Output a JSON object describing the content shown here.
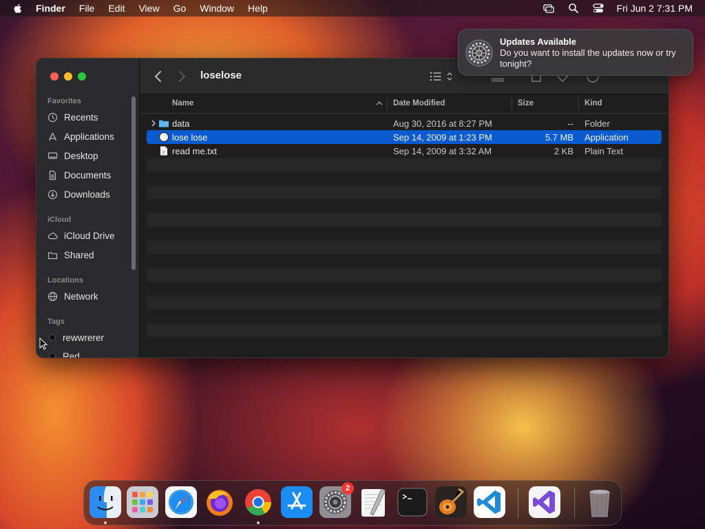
{
  "menubar": {
    "app_name": "Finder",
    "menus": [
      "File",
      "Edit",
      "View",
      "Go",
      "Window",
      "Help"
    ],
    "clock": "Fri Jun 2  7:31 PM"
  },
  "window": {
    "title": "loselose",
    "sidebar": {
      "favorites_label": "Favorites",
      "favorites": [
        {
          "label": "Recents",
          "icon": "clock-icon"
        },
        {
          "label": "Applications",
          "icon": "applications-icon"
        },
        {
          "label": "Desktop",
          "icon": "desktop-icon"
        },
        {
          "label": "Documents",
          "icon": "document-icon"
        },
        {
          "label": "Downloads",
          "icon": "download-icon"
        }
      ],
      "icloud_label": "iCloud",
      "icloud": [
        {
          "label": "iCloud Drive",
          "icon": "cloud-icon"
        },
        {
          "label": "Shared",
          "icon": "shared-folder-icon"
        }
      ],
      "locations_label": "Locations",
      "locations": [
        {
          "label": "Network",
          "icon": "globe-icon"
        }
      ],
      "tags_label": "Tags",
      "tags": [
        {
          "label": "rewwrerer"
        },
        {
          "label": "Red"
        }
      ]
    },
    "columns": {
      "name": "Name",
      "date": "Date Modified",
      "size": "Size",
      "kind": "Kind"
    },
    "files": [
      {
        "name": "data",
        "date": "Aug 30, 2016 at 8:27 PM",
        "size": "--",
        "kind": "Folder",
        "icon": "folder-icon",
        "selected": false
      },
      {
        "name": "lose lose",
        "date": "Sep 14, 2009 at 1:23 PM",
        "size": "5.7 MB",
        "kind": "Application",
        "icon": "application-icon",
        "selected": true
      },
      {
        "name": "read me.txt",
        "date": "Sep 14, 2009 at 3:32 AM",
        "size": "2 KB",
        "kind": "Plain Text",
        "icon": "text-file-icon",
        "selected": false
      }
    ]
  },
  "notification": {
    "title": "Updates Available",
    "body": "Do you want to install the updates now or try tonight?"
  },
  "dock": {
    "system_settings_badge": "2",
    "apps": [
      "Finder",
      "Launchpad",
      "Safari",
      "Firefox",
      "Chrome",
      "App Store",
      "System Settings",
      "TextEdit",
      "Terminal",
      "GarageBand",
      "Visual Studio Code",
      "Visual Studio",
      "Trash"
    ]
  },
  "colors": {
    "selection": "#0a5ad0",
    "close": "#fe5f57",
    "minimize": "#febc2e",
    "maximize": "#28c840",
    "badge": "#f03a30"
  }
}
